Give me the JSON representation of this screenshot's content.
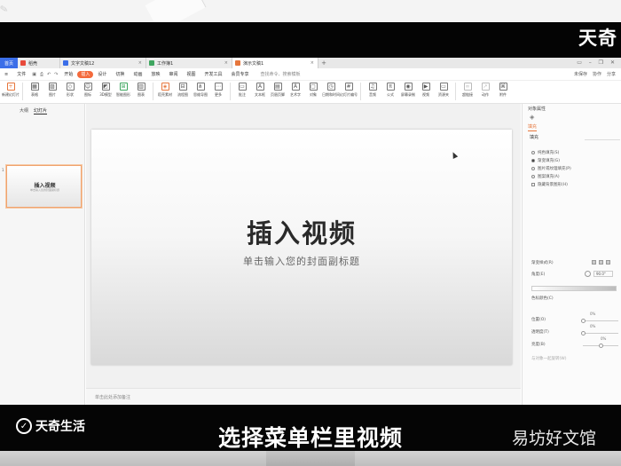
{
  "photo": {
    "top_logo": "天奇",
    "overlay_logo": "天奇生活",
    "caption": "选择菜单栏里视频",
    "watermark": "易坊好文馆"
  },
  "tabbar": {
    "home": "首页",
    "tabs": [
      {
        "label": "稻壳",
        "icon_color": "#e84a3b",
        "active": false
      },
      {
        "label": "文字文稿12",
        "icon_color": "#3b6ee8",
        "active": false
      },
      {
        "label": "工作簿1",
        "icon_color": "#3fa660",
        "active": false
      },
      {
        "label": "演示文稿1",
        "icon_color": "#e6763c",
        "active": true
      }
    ],
    "add": "+"
  },
  "menubar": {
    "items": [
      "开始",
      "插入",
      "设计",
      "切换",
      "动画",
      "放映",
      "审阅",
      "视图",
      "开发工具",
      "会员专享"
    ],
    "selected": "插入",
    "search": "查找命令、搜索模板",
    "file": "文件",
    "right": [
      "未保存",
      "协作",
      "分享"
    ]
  },
  "ribbon": {
    "groups": [
      {
        "items": [
          {
            "label": "新建幻灯片",
            "icon": "plus-icon"
          }
        ]
      },
      {
        "items": [
          {
            "label": "表格",
            "icon": "table-icon"
          },
          {
            "label": "图片",
            "icon": "image-icon"
          },
          {
            "label": "形状",
            "icon": "shape-icon"
          },
          {
            "label": "图标",
            "icon": "icon-icon"
          },
          {
            "label": "3D模型",
            "icon": "cube-icon"
          },
          {
            "label": "智能图形",
            "icon": "smartart-icon"
          },
          {
            "label": "图表",
            "icon": "chart-icon"
          }
        ]
      },
      {
        "items": [
          {
            "label": "稻壳素材",
            "icon": "asset-icon"
          },
          {
            "label": "流程图",
            "icon": "flow-icon"
          },
          {
            "label": "思维导图",
            "icon": "mindmap-icon"
          },
          {
            "label": "更多",
            "icon": "more-icon"
          }
        ]
      },
      {
        "items": [
          {
            "label": "批注",
            "icon": "comment-icon"
          },
          {
            "label": "文本框",
            "icon": "textbox-icon"
          },
          {
            "label": "页眉页脚",
            "icon": "header-icon"
          },
          {
            "label": "艺术字",
            "icon": "wordart-icon"
          },
          {
            "label": "对象",
            "icon": "object-icon"
          },
          {
            "label": "日期和时间",
            "icon": "date-icon"
          },
          {
            "label": "幻灯片编号",
            "icon": "number-icon"
          }
        ]
      },
      {
        "items": [
          {
            "label": "音频",
            "icon": "audio-icon"
          },
          {
            "label": "公式",
            "icon": "formula-icon"
          },
          {
            "label": "屏幕录制",
            "icon": "record-icon"
          },
          {
            "label": "视频",
            "icon": "video-icon"
          },
          {
            "label": "资源夹",
            "icon": "resource-icon"
          }
        ]
      },
      {
        "items": [
          {
            "label": "超链接",
            "icon": "link-icon"
          },
          {
            "label": "动作",
            "icon": "action-icon"
          },
          {
            "label": "附件",
            "icon": "attach-icon"
          }
        ]
      }
    ]
  },
  "left_panel": {
    "tabs": [
      "大纲",
      "幻灯片"
    ],
    "active_tab": "幻灯片",
    "slide_number": "1",
    "thumb_title": "插入视频",
    "thumb_sub": "单击输入您的封面副标题",
    "add": "+"
  },
  "slide": {
    "title": "插入视频",
    "subtitle": "单击输入您的封面副标题"
  },
  "notes": "单击此处添加备注",
  "right_panel": {
    "header": "对象属性",
    "tab": "填充",
    "section": "填充",
    "options": [
      {
        "label": "纯色填充(S)",
        "selected": false
      },
      {
        "label": "渐变填充(G)",
        "selected": true
      },
      {
        "label": "图片或纹理填充(P)",
        "selected": false
      },
      {
        "label": "图案填充(A)",
        "selected": false
      }
    ],
    "checkbox": "隐藏背景图形(H)",
    "gradient_label": "渐变样式(R)",
    "angle_label": "角度(E)",
    "angle_value": "90.0°",
    "stops_label": "色标颜色(C)",
    "position_label": "位置(O)",
    "position_value": "0%",
    "transparency_label": "透明度(T)",
    "transparency_value": "0%",
    "brightness_label": "亮度(B)",
    "brightness_value": "0%",
    "apply_label": "与对象一起旋转(W)",
    "bottom_buttons": [
      "全部应用",
      "重置背景"
    ]
  },
  "colors": {
    "accent": "#e6763c",
    "home_tab": "#3b6ee8",
    "menu_selected": "#f46a3c"
  }
}
